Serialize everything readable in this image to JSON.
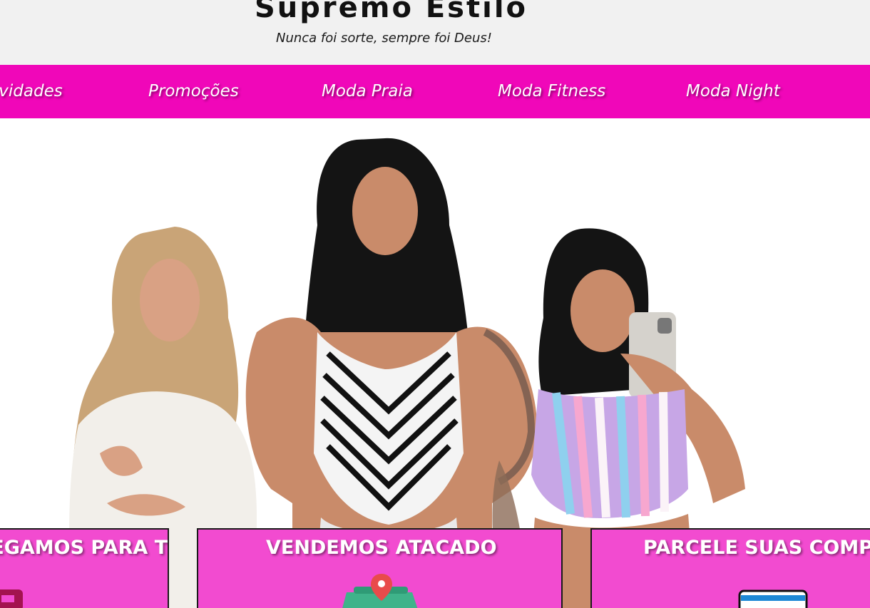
{
  "header": {
    "title": "Supremo Estilo",
    "tagline": "Nunca foi sorte, sempre foi Deus!"
  },
  "nav": {
    "items": [
      {
        "label": "Novidades"
      },
      {
        "label": "Promoções"
      },
      {
        "label": "Moda Praia"
      },
      {
        "label": "Moda Fitness"
      },
      {
        "label": "Moda Night"
      }
    ]
  },
  "hero": {
    "image_description_icons": [
      "model-white-outfit",
      "model-zigzag-bodysuit",
      "model-pastel-stripes-top"
    ]
  },
  "features": [
    {
      "title": "ENTREGAMOS PARA TODO O BRASIL",
      "icon": "delivery-truck-icon"
    },
    {
      "title": "VENDEMOS ATACADO",
      "icon": "store-location-icon"
    },
    {
      "title": "PARCELE SUAS COMPRAS",
      "icon": "credit-card-icon"
    }
  ],
  "colors": {
    "header_bg": "#f1f1f1",
    "nav_bg": "#f007b9",
    "card_bg": "#f24bd0"
  }
}
